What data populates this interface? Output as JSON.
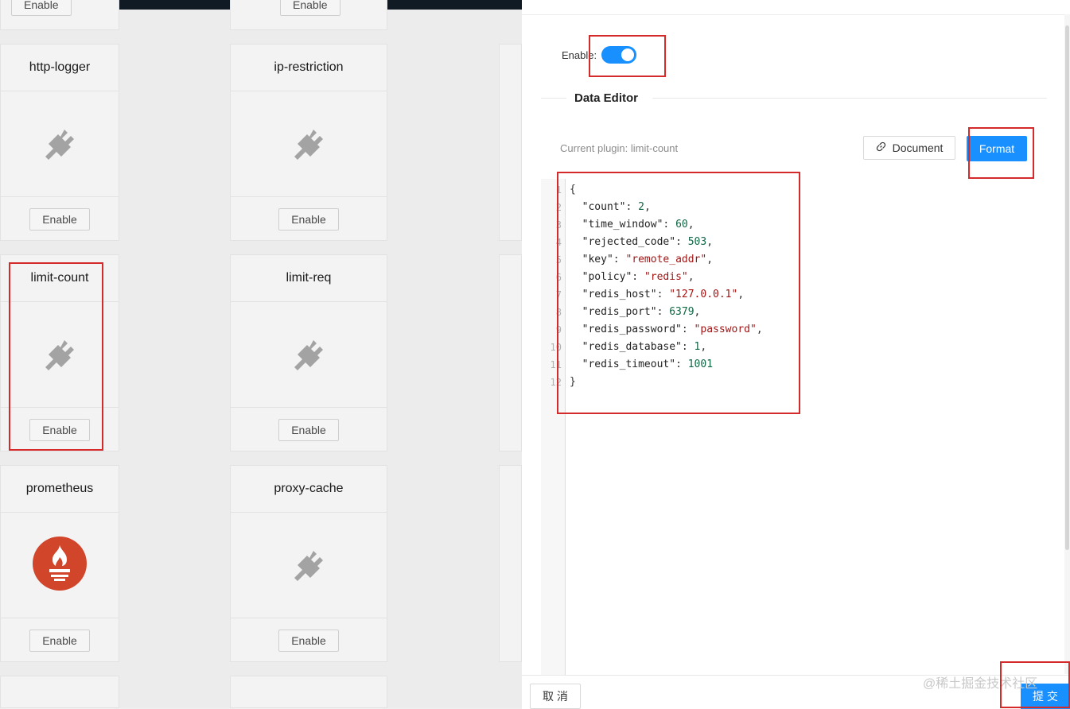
{
  "background_cards": {
    "top_row_buttons": [
      "Enable",
      "Enable"
    ],
    "cards": [
      {
        "title": "http-logger",
        "button": "Enable",
        "icon": "plug-icon"
      },
      {
        "title": "ip-restriction",
        "button": "Enable",
        "icon": "plug-icon"
      },
      {
        "title": "limit-count",
        "button": "Enable",
        "icon": "plug-icon"
      },
      {
        "title": "limit-req",
        "button": "Enable",
        "icon": "plug-icon"
      },
      {
        "title": "prometheus",
        "button": "Enable",
        "icon": "prometheus-logo-icon"
      },
      {
        "title": "proxy-cache",
        "button": "Enable",
        "icon": "plug-icon"
      }
    ]
  },
  "drawer": {
    "enable_label": "Enable:",
    "enabled": true,
    "section_title": "Data Editor",
    "current_plugin": "Current plugin: limit-count",
    "document_button": "Document",
    "format_button": "Format",
    "editor": {
      "line_numbers": [
        "1",
        "2",
        "3",
        "4",
        "5",
        "6",
        "7",
        "8",
        "9",
        "10",
        "11",
        "12"
      ],
      "lines": [
        "{",
        "  \"count\": 2,",
        "  \"time_window\": 60,",
        "  \"rejected_code\": 503,",
        "  \"key\": \"remote_addr\",",
        "  \"policy\": \"redis\",",
        "  \"redis_host\": \"127.0.0.1\",",
        "  \"redis_port\": 6379,",
        "  \"redis_password\": \"password\",",
        "  \"redis_database\": 1,",
        "  \"redis_timeout\": 1001",
        "}"
      ]
    },
    "cancel_button": "取 消",
    "submit_button": "提 交"
  },
  "watermark": "@稀土掘金技术社区",
  "colors": {
    "primary": "#1890ff",
    "highlight": "#d42a2a",
    "prometheus": "#d1462a"
  }
}
